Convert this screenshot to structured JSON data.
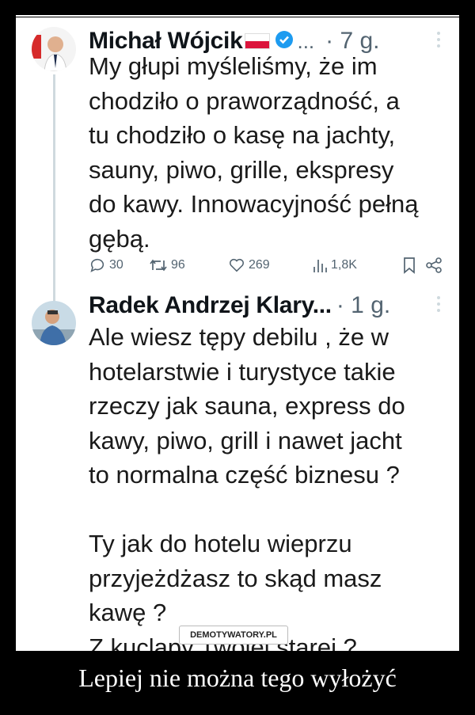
{
  "post": {
    "author": "Michał Wójcik",
    "ellipsis": "...",
    "time": "· 7 g.",
    "text": "My głupi myśleliśmy, że im\nchodziło o praworządność, a\ntu chodziło o kasę na jachty,\nsauny, piwo, grille, ekspresy\ndo kawy. Innowacyjność pełną\ngębą.",
    "replies": "30",
    "reposts": "96",
    "likes": "269",
    "views": "1,8K"
  },
  "reply": {
    "author": "Radek Andrzej Klary...",
    "time": "· 1 g.",
    "text": "Ale wiesz tępy debilu , że w\nhotelarstwie i turystyce takie\nrzeczy jak sauna, express do\nkawy, piwo, grill i nawet jacht\nto normalna część biznesu ?\n\nTy jak do hotelu wieprzu\nprzyjeżdżasz to skąd masz\nkawę ?\nZ kuclapy Twojej starej ?"
  },
  "watermark": "DEMOTYWATORY.PL",
  "caption": "Lepiej nie można tego wyłożyć",
  "colors": {
    "background": "#000000",
    "panel": "#ffffff",
    "verified": "#1d9bf0",
    "meta": "#536471",
    "flag_red": "#dc143c"
  },
  "icons": [
    "reply-icon",
    "repost-icon",
    "like-icon",
    "views-icon",
    "bookmark-icon",
    "share-icon",
    "verified-icon",
    "more-icon"
  ]
}
